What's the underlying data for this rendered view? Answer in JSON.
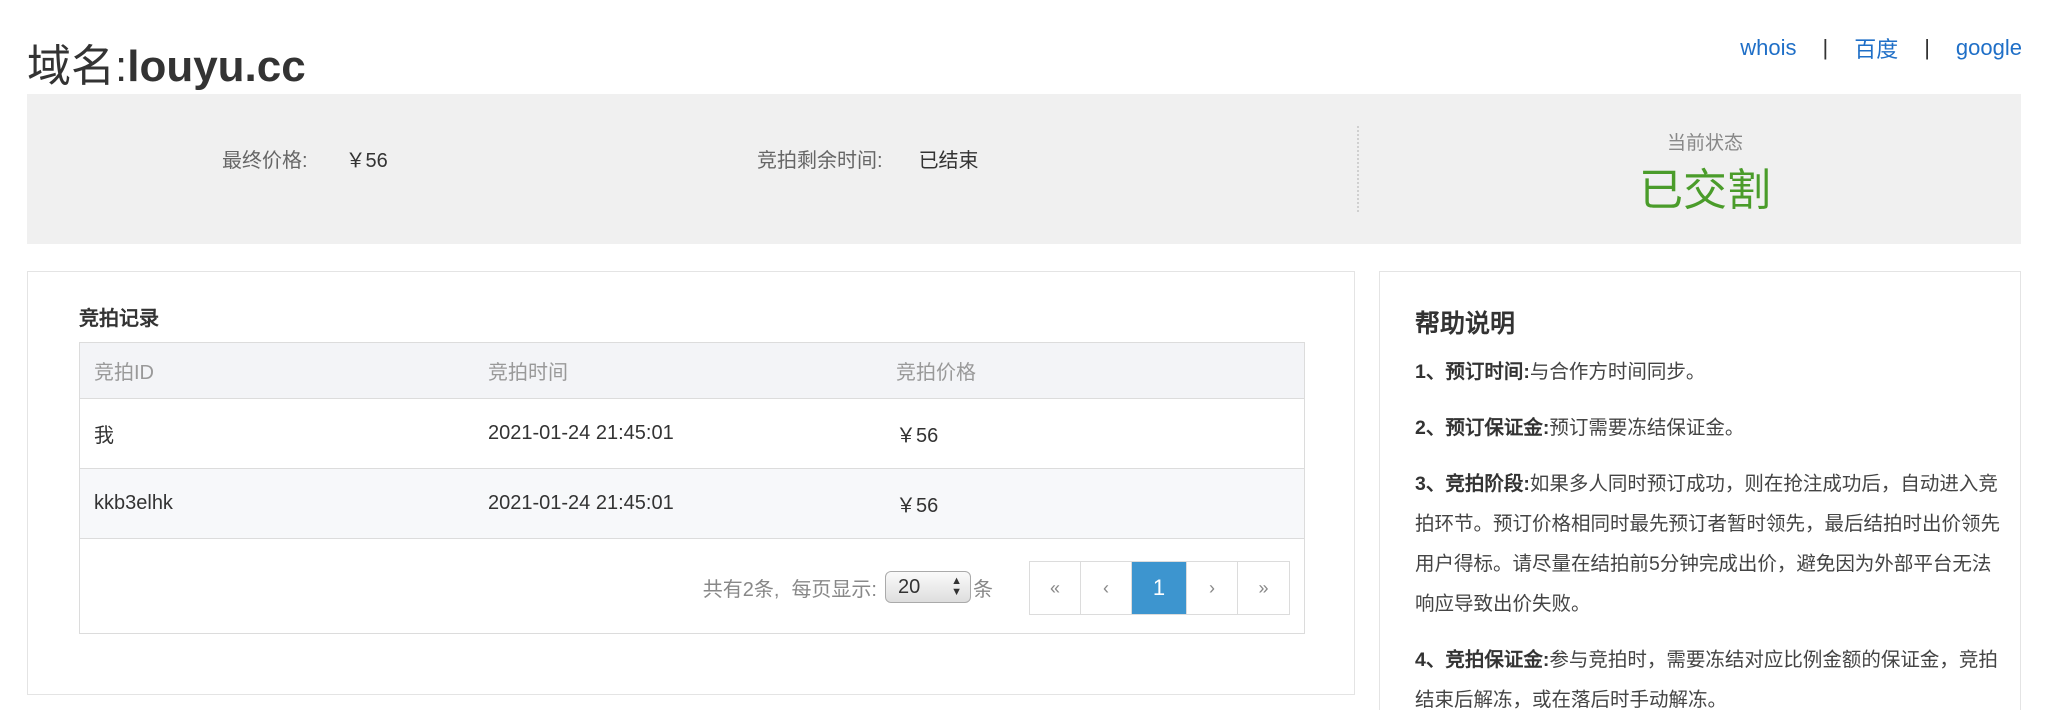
{
  "header": {
    "domain_label": "域名:",
    "domain_value": "louyu.cc",
    "links": [
      "whois",
      "百度",
      "google"
    ],
    "separator": "|"
  },
  "status": {
    "final_price_label": "最终价格:",
    "final_price_value": "￥56",
    "remaining_label": "竞拍剩余时间:",
    "remaining_value": "已结束",
    "state_label": "当前状态",
    "state_value": "已交割",
    "state_color": "#4a9c2a"
  },
  "records": {
    "title": "竞拍记录",
    "columns": [
      "竞拍ID",
      "竞拍时间",
      "竞拍价格"
    ],
    "rows": [
      [
        "我",
        "2021-01-24 21:45:01",
        "￥56"
      ],
      [
        "kkb3elhk",
        "2021-01-24 21:45:01",
        "￥56"
      ]
    ],
    "pager": {
      "total": "共有2条,",
      "per_page_label": "每页显示:",
      "page_size": "20",
      "unit": "条",
      "buttons": [
        "«",
        "‹",
        "1",
        "›",
        "»"
      ],
      "current": "1",
      "accent": "#3d95cf"
    }
  },
  "help": {
    "title": "帮助说明",
    "items": [
      {
        "head": "1、预订时间:",
        "body": "与合作方时间同步。"
      },
      {
        "head": "2、预订保证金:",
        "body": "预订需要冻结保证金。"
      },
      {
        "head": "3、竞拍阶段:",
        "body": "如果多人同时预订成功，则在抢注成功后，自动进入竞拍环节。预订价格相同时最先预订者暂时领先，最后结拍时出价领先用户得标。请尽量在结拍前5分钟完成出价，避免因为外部平台无法响应导致出价失败。"
      },
      {
        "head": "4、竞拍保证金:",
        "body": "参与竞拍时，需要冻结对应比例金额的保证金，竞拍结束后解冻，或在落后时手动解冻。"
      }
    ]
  }
}
